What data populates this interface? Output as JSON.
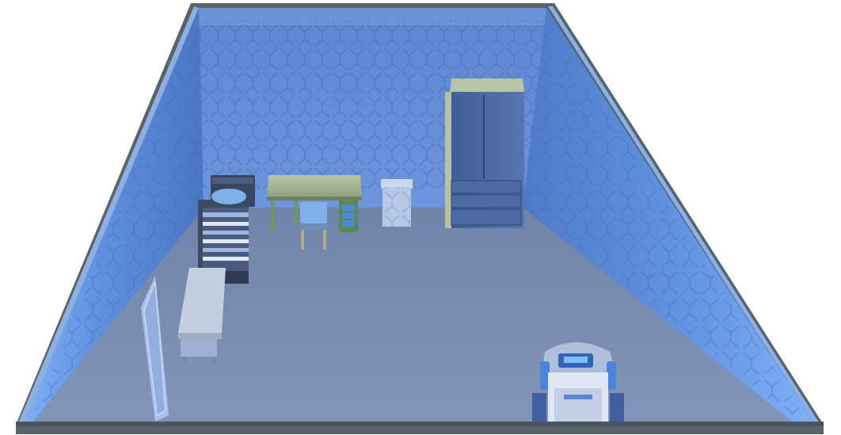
{
  "scene": {
    "view": "build-mode-room-overhead",
    "colors": {
      "background": "#ffffff",
      "wall_top_trim": "#5f6b74",
      "wall_blue_light": "#6f9fe8",
      "wall_blue_mid": "#4f7fcf",
      "wall_blue_dark": "#3b5fa3",
      "floor": "#7e91b4",
      "floor_dark": "#6d809f"
    }
  },
  "objects": [
    {
      "name": "single-bed",
      "icon": "bed-icon"
    },
    {
      "name": "desk",
      "icon": "desk-icon"
    },
    {
      "name": "desk-chair",
      "icon": "chair-icon"
    },
    {
      "name": "laundry-hamper",
      "icon": "hamper-icon"
    },
    {
      "name": "wardrobe",
      "icon": "wardrobe-icon"
    },
    {
      "name": "dresser",
      "icon": "dresser-icon"
    },
    {
      "name": "door",
      "icon": "door-icon"
    },
    {
      "name": "treadmill",
      "icon": "treadmill-icon"
    }
  ]
}
